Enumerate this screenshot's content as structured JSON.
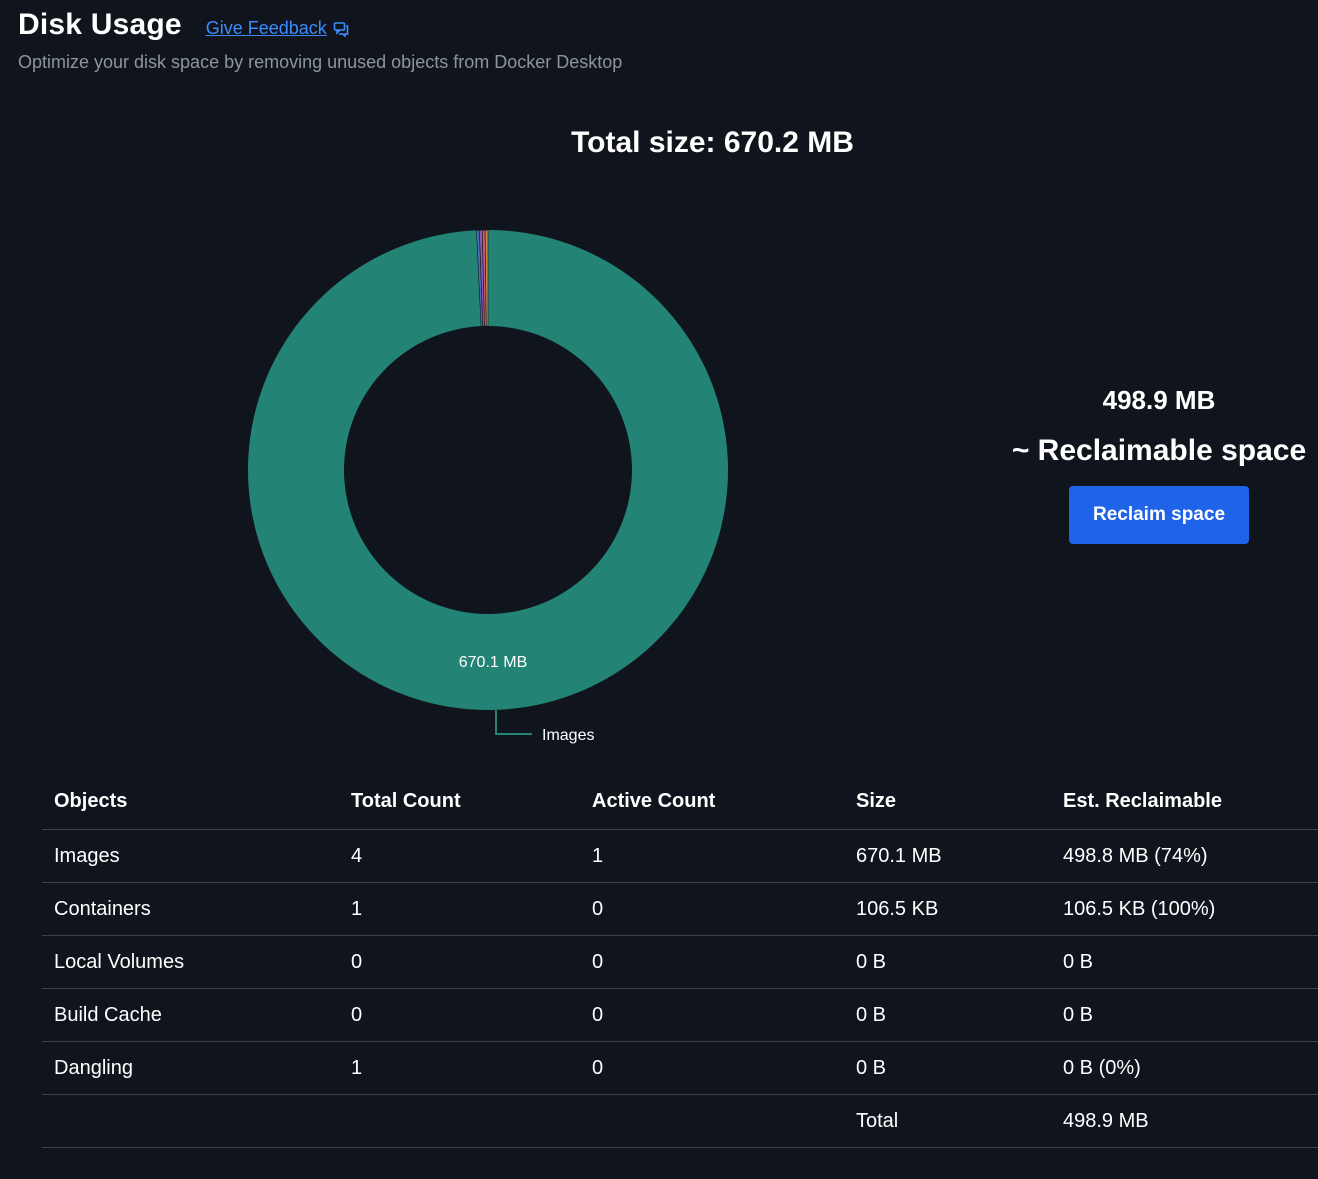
{
  "header": {
    "title": "Disk Usage",
    "feedback_label": "Give Feedback",
    "subtitle": "Optimize your disk space by removing unused objects from Docker Desktop"
  },
  "summary": {
    "total_size": "Total size: 670.2 MB",
    "reclaimable_amount": "498.9 MB",
    "reclaimable_label": "~ Reclaimable space",
    "reclaim_button": "Reclaim space"
  },
  "chart_data": {
    "type": "pie",
    "donut": true,
    "unit": "MB",
    "categories": [
      "Images",
      "Containers",
      "Local Volumes",
      "Build Cache",
      "Dangling"
    ],
    "values": [
      670.1,
      0.1065,
      0,
      0,
      0
    ],
    "slice_label": "670.1 MB",
    "callout_label": "Images",
    "colors": [
      "#238476",
      "#4b6fb0",
      "#8a5ab5",
      "#c25a7a",
      "#d1863f"
    ]
  },
  "table": {
    "headers": [
      "Objects",
      "Total Count",
      "Active Count",
      "Size",
      "Est. Reclaimable"
    ],
    "rows": [
      [
        "Images",
        "4",
        "1",
        "670.1 MB",
        "498.8 MB (74%)"
      ],
      [
        "Containers",
        "1",
        "0",
        "106.5 KB",
        "106.5 KB (100%)"
      ],
      [
        "Local Volumes",
        "0",
        "0",
        "0 B",
        "0 B"
      ],
      [
        "Build Cache",
        "0",
        "0",
        "0 B",
        "0 B"
      ],
      [
        "Dangling",
        "1",
        "0",
        "0 B",
        "0 B (0%)"
      ],
      [
        "",
        "",
        "",
        "Total",
        "498.9 MB"
      ]
    ]
  },
  "colors": {
    "background": "#10151d",
    "accent": "#1f63e8",
    "link": "#3d8bff"
  }
}
